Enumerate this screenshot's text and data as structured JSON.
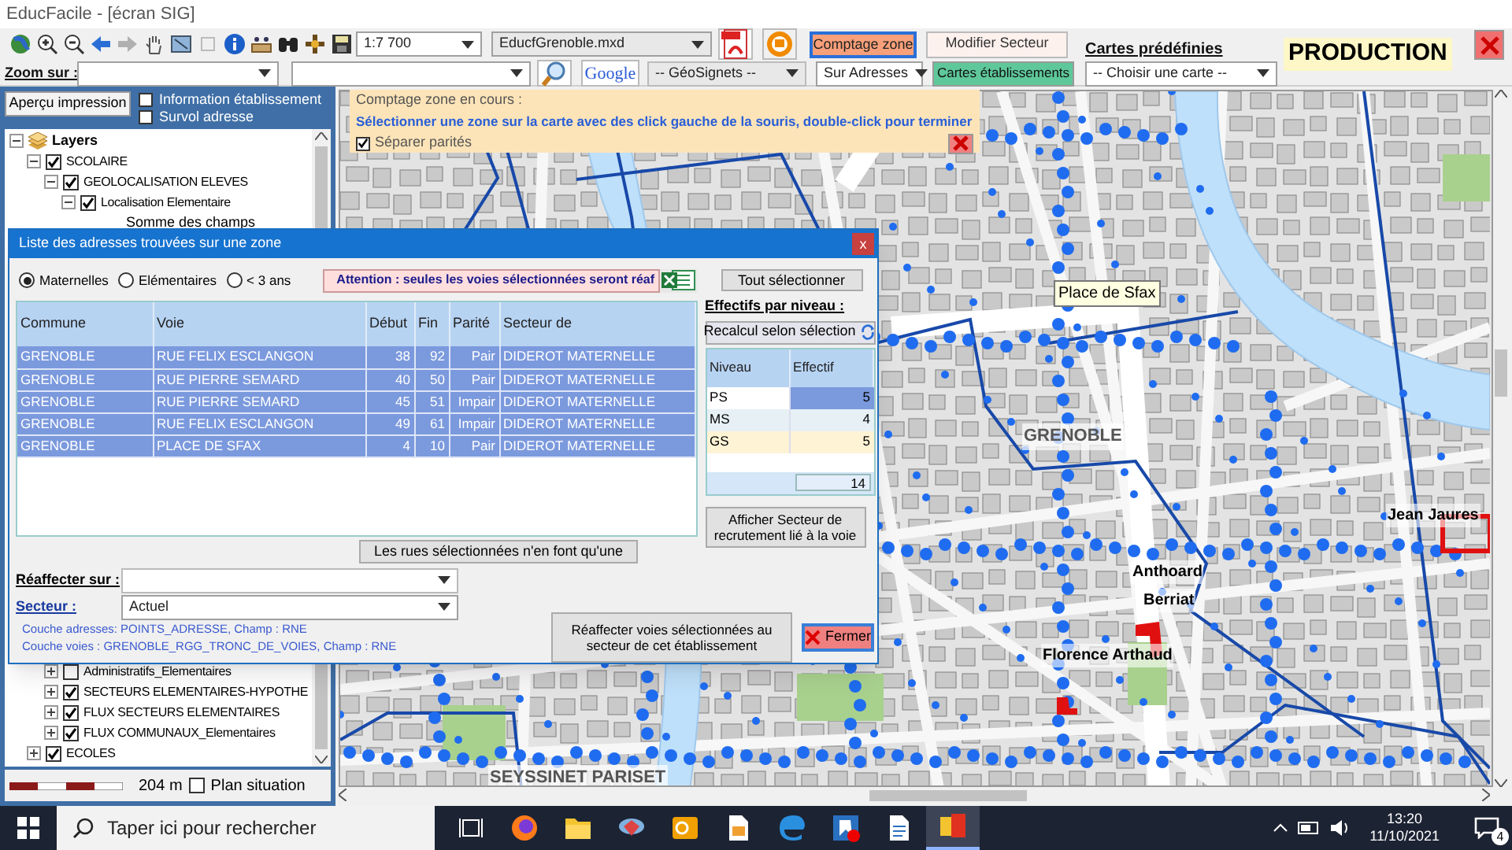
{
  "window": {
    "title": "EducFacile - [écran SIG]"
  },
  "toolbar": {
    "scale": "1:7 700",
    "document": "EducfGrenoble.mxd",
    "count_zone_button": {
      "label": "Comptage zone",
      "selected": true
    },
    "modify_sector_button": "Modifier Secteur",
    "predefined_maps_label": "Cartes prédéfinies",
    "environment_badge": "PRODUCTION",
    "zoom_label": "Zoom sur :",
    "google_button": "Google",
    "geosignets": "-- GéoSignets --",
    "search_mode": "Sur Adresses",
    "school_maps_button": "Cartes établissements",
    "map_choice": "-- Choisir une carte --"
  },
  "left_panel": {
    "print_preview_button": "Aperçu impression",
    "options": [
      {
        "label": "Information établissement",
        "checked": false
      },
      {
        "label": "Survol adresse",
        "checked": false
      }
    ],
    "tree": [
      {
        "label": "Layers",
        "kind": "group",
        "expanded": true,
        "children": [
          {
            "label": "SCOLAIRE",
            "kind": "layer",
            "checked": true,
            "expanded": true,
            "children": [
              {
                "label": "GEOLOCALISATION ELEVES",
                "kind": "layer",
                "checked": true,
                "expanded": true,
                "children": [
                  {
                    "label": "Localisation Elementaire",
                    "kind": "layer",
                    "checked": true,
                    "expanded": true,
                    "children": [
                      {
                        "label": "Somme des champs",
                        "kind": "field"
                      }
                    ]
                  }
                ]
              }
            ]
          }
        ]
      }
    ],
    "tree_lower": [
      {
        "children": [
          {
            "label": "Administratifs_Elementaires",
            "kind": "layer",
            "checked": false,
            "expanded": false
          },
          {
            "label": "SECTEURS ELEMENTAIRES-HYPOTHE",
            "kind": "layer",
            "checked": true,
            "expanded": false
          },
          {
            "label": "FLUX SECTEURS ELEMENTAIRES",
            "kind": "layer",
            "checked": true,
            "expanded": false
          },
          {
            "label": "FLUX COMMUNAUX_Elementaires",
            "kind": "layer",
            "checked": true,
            "expanded": false
          }
        ]
      },
      {
        "label": "ECOLES",
        "kind": "layer",
        "checked": true,
        "expanded": false
      }
    ],
    "scale_label": "204 m",
    "overview_option": {
      "label": "Plan situation",
      "checked": false
    }
  },
  "count_banner": {
    "title": "Comptage zone en cours :",
    "instruction": "Sélectionner une zone sur la carte avec des click gauche de la souris, double-click pour terminer",
    "split_parity": {
      "label": "Séparer parités",
      "checked": true
    }
  },
  "map": {
    "labels": [
      {
        "text": "Place de Sfax",
        "kind": "tooltip"
      },
      {
        "text": "GRENOBLE",
        "kind": "commune"
      },
      {
        "text": "Jean Jaures",
        "kind": "school"
      },
      {
        "text": "Anthoard",
        "kind": "school"
      },
      {
        "text": "Berriat",
        "kind": "school"
      },
      {
        "text": "Florence Arthaud",
        "kind": "school"
      },
      {
        "text": "SEYSSINET PARISET",
        "kind": "commune"
      }
    ]
  },
  "dialog": {
    "title": "Liste des adresses trouvées sur une zone",
    "close": "x",
    "levels": [
      {
        "label": "Maternelles",
        "selected": true
      },
      {
        "label": "Elémentaires",
        "selected": false
      },
      {
        "label": "< 3 ans",
        "selected": false
      }
    ],
    "warning": "Attention : seules les voies sélectionnées seront réaf",
    "select_all_button": "Tout sélectionner",
    "table": {
      "columns": [
        "Commune",
        "Voie",
        "Début",
        "Fin",
        "Parité",
        "Secteur de"
      ],
      "rows": [
        {
          "cells": [
            "GRENOBLE",
            "RUE FELIX ESCLANGON",
            "38",
            "92",
            "Pair",
            "DIDEROT MATERNELLE"
          ],
          "selected": true
        },
        {
          "cells": [
            "GRENOBLE",
            "RUE PIERRE SEMARD",
            "40",
            "50",
            "Pair",
            "DIDEROT MATERNELLE"
          ],
          "selected": true
        },
        {
          "cells": [
            "GRENOBLE",
            "RUE PIERRE SEMARD",
            "45",
            "51",
            "Impair",
            "DIDEROT MATERNELLE"
          ],
          "selected": true
        },
        {
          "cells": [
            "GRENOBLE",
            "RUE FELIX ESCLANGON",
            "49",
            "61",
            "Impair",
            "DIDEROT MATERNELLE"
          ],
          "selected": true
        },
        {
          "cells": [
            "GRENOBLE",
            "PLACE DE SFAX",
            "4",
            "10",
            "Pair",
            "DIDEROT MATERNELLE"
          ],
          "selected": true
        }
      ]
    },
    "headcount_label": "Effectifs par niveau :",
    "recalc_button": "Recalcul selon sélection",
    "headcount": {
      "columns": [
        "Niveau",
        "Effectif"
      ],
      "rows": [
        {
          "level_name": "PS",
          "count": "5",
          "selected": true,
          "color": "#ffffff"
        },
        {
          "level_name": "MS",
          "count": "4",
          "selected": false,
          "color": "#e6f0f5"
        },
        {
          "level_name": "GS",
          "count": "5",
          "selected": false,
          "color": "#fff3d6"
        }
      ],
      "total": "14"
    },
    "show_sector_button": "Afficher Secteur de recrutement lié à la voie",
    "merge_streets_button": "Les rues sélectionnées n'en font qu'une",
    "reassign_label": "Réaffecter sur :",
    "sector_label": "Secteur :",
    "sector_value": "Actuel",
    "info_lines": [
      "Couche adresses: POINTS_ADRESSE, Champ : RNE",
      "Couche voies : GRENOBLE_RGG_TRONC_DE_VOIES, Champ : RNE"
    ],
    "reassign_button": "Réaffecter voies sélectionnées au secteur de cet établissement",
    "close_button": "Fermer"
  },
  "taskbar": {
    "search_placeholder": "Taper ici pour rechercher",
    "time": "13:20",
    "date": "11/10/2021",
    "notifications": "4"
  }
}
